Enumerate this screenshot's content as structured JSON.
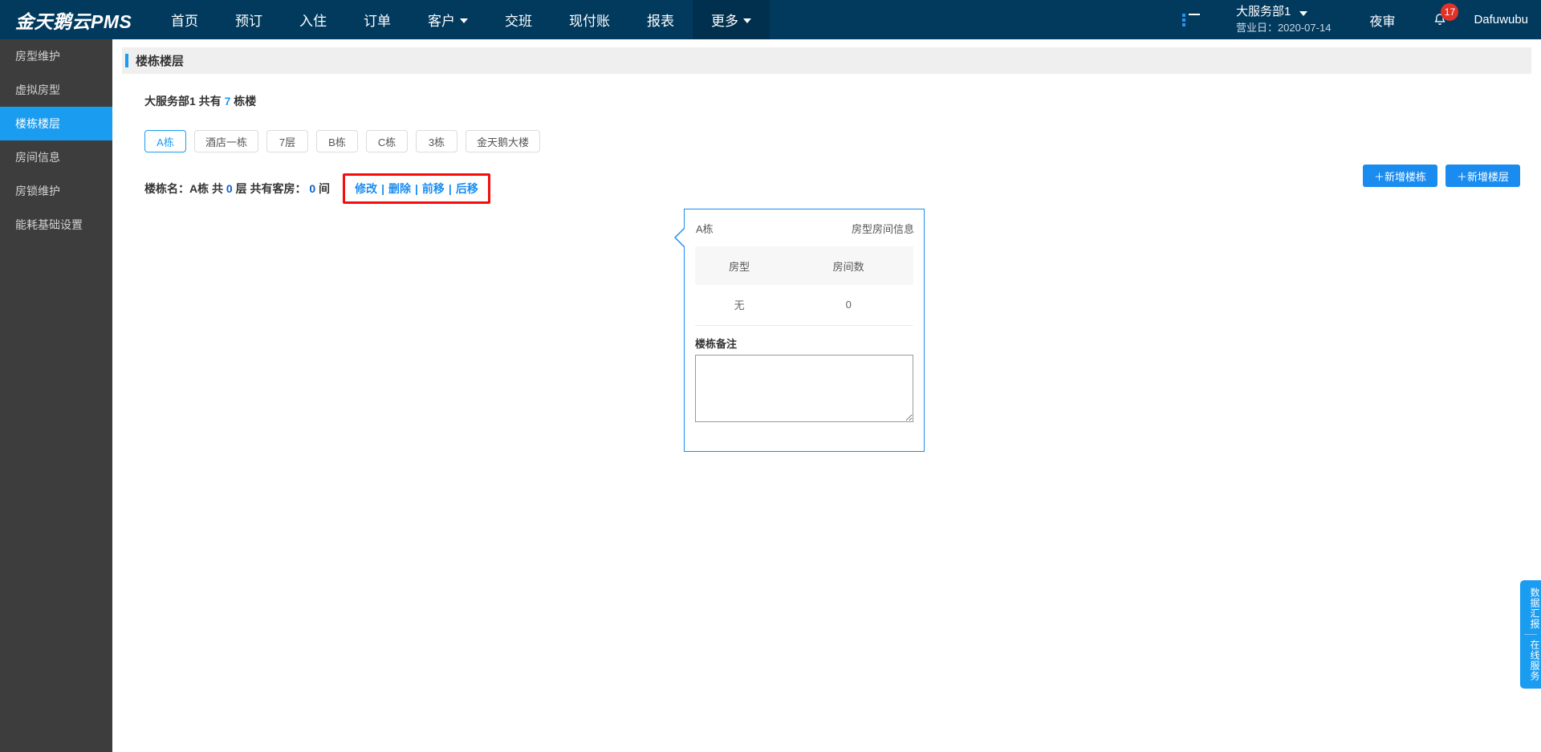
{
  "header": {
    "logo": "金天鹅云PMS",
    "nav": [
      {
        "label": "首页",
        "has_caret": false,
        "active": false
      },
      {
        "label": "预订",
        "has_caret": false,
        "active": false
      },
      {
        "label": "入住",
        "has_caret": false,
        "active": false
      },
      {
        "label": "订单",
        "has_caret": false,
        "active": false
      },
      {
        "label": "客户",
        "has_caret": true,
        "active": false
      },
      {
        "label": "交班",
        "has_caret": false,
        "active": false
      },
      {
        "label": "现付账",
        "has_caret": false,
        "active": false
      },
      {
        "label": "报表",
        "has_caret": false,
        "active": false
      },
      {
        "label": "更多",
        "has_caret": true,
        "active": true
      }
    ],
    "list_icon": "list-icon",
    "department": "大服务部1",
    "business_date_label": "营业日：2020-07-14",
    "night_audit": "夜审",
    "bell_icon": "bell-icon",
    "notification_count": "17",
    "username": "Dafuwubu"
  },
  "sidebar": {
    "items": [
      {
        "label": "房型维护",
        "active": false
      },
      {
        "label": "虚拟房型",
        "active": false
      },
      {
        "label": "楼栋楼层",
        "active": true
      },
      {
        "label": "房间信息",
        "active": false
      },
      {
        "label": "房锁维护",
        "active": false
      },
      {
        "label": "能耗基础设置",
        "active": false
      }
    ]
  },
  "main": {
    "page_title": "楼栋楼层",
    "summary": {
      "prefix": "大服务部1 共有 ",
      "count": "7",
      "suffix": " 栋楼"
    },
    "building_tabs": [
      {
        "label": "A栋",
        "active": true
      },
      {
        "label": "酒店一栋",
        "active": false
      },
      {
        "label": "7层",
        "active": false
      },
      {
        "label": "B栋",
        "active": false
      },
      {
        "label": "C栋",
        "active": false
      },
      {
        "label": "3栋",
        "active": false
      },
      {
        "label": "金天鹅大楼",
        "active": false
      }
    ],
    "info_row": {
      "label_building": "楼栋名：",
      "building_name": "A栋",
      "floors_prefix": " 共 ",
      "floors_count": "0",
      "floors_suffix": " 层 ",
      "rooms_prefix": "共有客房： ",
      "rooms_count": "0",
      "rooms_suffix": " 间",
      "actions": [
        {
          "label": "修改"
        },
        {
          "label": "删除"
        },
        {
          "label": "前移"
        },
        {
          "label": "后移"
        }
      ],
      "separator": "|",
      "highlight_color": "#f50d0d"
    },
    "buttons": {
      "add_building": "＋新增楼栋",
      "add_floor": "＋新增楼层"
    }
  },
  "detail_card": {
    "building_name": "A栋",
    "title": "房型房间信息",
    "table": {
      "columns": [
        "房型",
        "房间数"
      ],
      "rows": [
        [
          "无",
          "0"
        ]
      ]
    },
    "remark_label": "楼栋备注",
    "remark_value": "",
    "remark_placeholder": ""
  },
  "float_tabs": [
    {
      "label": "数据汇报"
    },
    {
      "label": "在线服务"
    }
  ],
  "colors": {
    "header_bg": "#023a5e",
    "header_active": "#01304e",
    "sidebar_bg": "#3d3d3d",
    "accent_blue": "#1a9cf0",
    "link_blue": "#1a8cf0",
    "badge_red": "#e03226",
    "annotation_red": "#f50d0d"
  }
}
